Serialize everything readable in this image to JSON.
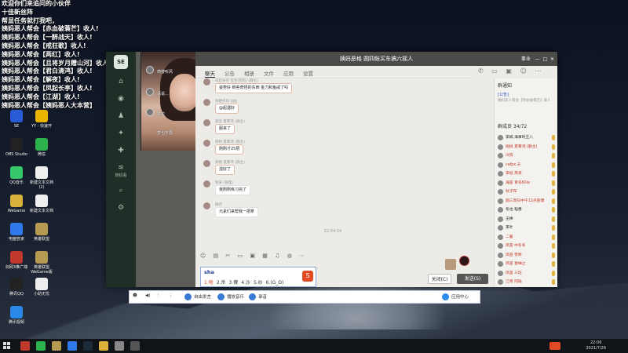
{
  "overlay_lines": [
    "欢迎你们来追问的小伙伴",
    "十佳新丝阵",
    "帮显任务就打我吧，",
    "姨妈恶人帮会【赤血破蓑芒】收人!",
    "姨妈恶人帮会【一醉战天】收人!",
    "姨妈恶人帮会【戒狂歌】收人!",
    "姨妈恶人帮会【两红】收人!",
    "姨妈恶人帮会【且将岁月赠山河】收人!",
    "姨妈恶人帮会【君白清鸿】收人!",
    "姨妈恶人帮会【解夜】收人!",
    "姨妈恶人帮会【凤起长亭】收人!",
    "姨妈恶人帮会【江湖】收人!",
    "姨妈恶人帮会【姨妈恶人大本营】"
  ],
  "desktop_icons": [
    {
      "label": "SE",
      "color": "#2a5bd7"
    },
    {
      "label": "YY - 快速开",
      "color": "#e8b400"
    },
    {
      "label": "OBS Studio",
      "color": "#222"
    },
    {
      "label": "微信",
      "color": "#2bb24c"
    },
    {
      "label": "QQ音乐",
      "color": "#36c76b"
    },
    {
      "label": "新建文本文档 (2)",
      "color": "#eee"
    },
    {
      "label": "WeGame",
      "color": "#d9b13a"
    },
    {
      "label": "新建文本文档",
      "color": "#eee"
    },
    {
      "label": "电脑管家",
      "color": "#2f79ea"
    },
    {
      "label": "英雄联盟",
      "color": "#b79a52"
    },
    {
      "label": "剑网3推广端",
      "color": "#c0392b"
    },
    {
      "label": "英雄联盟 WeGame版",
      "color": "#b79a52"
    },
    {
      "label": "腾讯QQ",
      "color": "#222"
    },
    {
      "label": "小助无忧",
      "color": "#eee"
    },
    {
      "label": "腾讯视频",
      "color": "#2b88e6"
    }
  ],
  "sidebar": {
    "logo": "SE",
    "items": [
      {
        "icon": "home-icon",
        "glyph": "⌂"
      },
      {
        "icon": "chat-icon",
        "glyph": "◉"
      },
      {
        "icon": "people-icon",
        "glyph": "♟"
      },
      {
        "icon": "game-icon",
        "glyph": "✦"
      },
      {
        "icon": "puzzle-icon",
        "glyph": "✚"
      },
      {
        "icon": "wifi-icon",
        "glyph": "≋",
        "label": "随机看"
      },
      {
        "icon": "search-icon",
        "glyph": "⌕"
      },
      {
        "icon": "settings-icon",
        "glyph": "⚙"
      }
    ]
  },
  "video": {
    "labels": [
      "倚楼听风",
      "请说…",
      "桃花",
      "梦也不再"
    ]
  },
  "window": {
    "title": "姨妈恶格 圆四账买车搞六摇人",
    "mode": "事业"
  },
  "tabs": [
    "聊天",
    "公告",
    "相册",
    "文件",
    "应用",
    "设置"
  ],
  "messages": [
    {
      "name": "凤起长亭 宝宝(狗狗) (群主)",
      "text": "姿势好 刷些奇怪的东西 金刀和鱼咸了吗"
    },
    {
      "name": "倚楼听风 仙仙",
      "text": "@起遇好"
    },
    {
      "name": "菠菜 夏雾鸢 (群主)",
      "text": "服来了"
    },
    {
      "name": "倚桥 夏雾鸢 (群主)",
      "text": "刚刚才25层"
    },
    {
      "name": "倚楼 夏雾鸢 (群主)",
      "text": "混好了"
    },
    {
      "name": "秋来 (管理)",
      "text": "我刚刚练习完了"
    },
    {
      "name": "梅月",
      "text": "元素们来帮我一把拿"
    }
  ],
  "timestamp": "22:04:54",
  "input": {
    "text": "sha",
    "close_label": "关闭(C)",
    "send_label": "发送(S)"
  },
  "notice": {
    "title": "群通知",
    "tag": "[公告]",
    "text": "姨妈恶人帮会【赤血破蓑芒】收人",
    "members_label": "群成员 34/72"
  },
  "members": [
    {
      "name": "李嫣 海事时王八",
      "color": "#222"
    },
    {
      "name": "桃桃 夏雾鸢 (群主)",
      "color": "#c0392b"
    },
    {
      "name": "冷狗",
      "color": "#c0392b"
    },
    {
      "name": "cafpx.天",
      "color": "#c0392b"
    },
    {
      "name": "李纸 蒸浪",
      "color": "#c0392b"
    },
    {
      "name": "海茵 青鸟60w",
      "color": "#c0392b"
    },
    {
      "name": "秋子布",
      "color": "#c0392b"
    },
    {
      "name": "圆三周日中午12点惹爆",
      "color": "#c0392b"
    },
    {
      "name": "冬也 稻香",
      "color": "#222"
    },
    {
      "name": "王捧",
      "color": "#222"
    },
    {
      "name": "茶叶",
      "color": "#222"
    },
    {
      "name": "二酱",
      "color": "#c0392b"
    },
    {
      "name": "凤茵 中冬冬",
      "color": "#c0392b"
    },
    {
      "name": "凤茵 雪柴",
      "color": "#c0392b"
    },
    {
      "name": "凤茵 春柚之",
      "color": "#c0392b"
    },
    {
      "name": "凤茵 三坨",
      "color": "#c0392b"
    },
    {
      "name": "江南 阿陆",
      "color": "#c0392b"
    }
  ],
  "ime": {
    "composition": "sha",
    "candidates": [
      "1.啥",
      "2.杀",
      "3.傻",
      "4.沙",
      "5.纱",
      "6.(G_O)"
    ]
  },
  "streambar": {
    "items": [
      "自由发言",
      "播放音乐",
      "录音"
    ],
    "status": "应用中心"
  },
  "clock": {
    "time": "22:06",
    "date": "2021/7/26"
  }
}
